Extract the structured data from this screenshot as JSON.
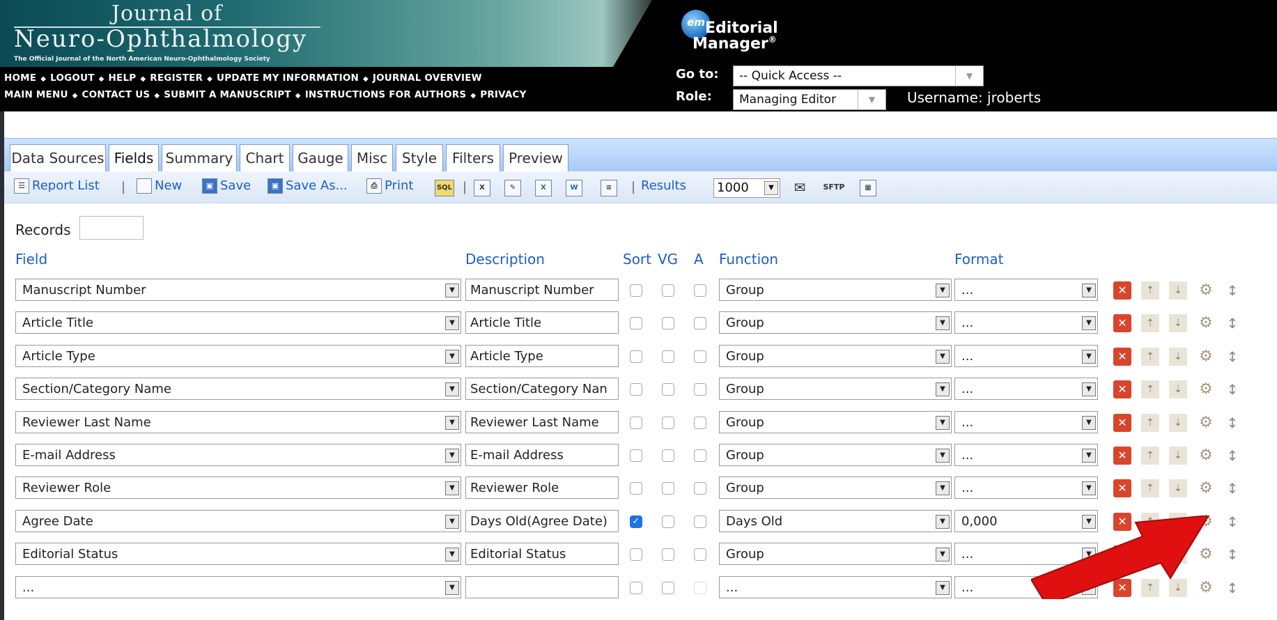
{
  "header": {
    "journal_line1": "Journal of",
    "journal_line2": "Neuro-Ophthalmology",
    "journal_sub": "The Official Journal of the North American Neuro-Ophthalmology Society",
    "nav_row1": [
      "HOME",
      "LOGOUT",
      "HELP",
      "REGISTER",
      "UPDATE MY INFORMATION",
      "JOURNAL OVERVIEW"
    ],
    "nav_row2": [
      "MAIN MENU",
      "CONTACT US",
      "SUBMIT A MANUSCRIPT",
      "INSTRUCTIONS FOR AUTHORS",
      "PRIVACY"
    ],
    "em_badge": "em",
    "em_title1": "Editorial",
    "em_title2": "Manager",
    "em_trademark": "®",
    "goto_label": "Go to:",
    "quick_access": "-- Quick Access --",
    "role_label": "Role:",
    "role_value": "Managing Editor",
    "username": "Username: jroberts"
  },
  "tabs": [
    "Data Sources",
    "Fields",
    "Summary",
    "Chart",
    "Gauge",
    "Misc",
    "Style",
    "Filters",
    "Preview"
  ],
  "active_tab": "Fields",
  "toolbar": {
    "report_list": "Report List",
    "new": "New",
    "save": "Save",
    "save_as": "Save As...",
    "print": "Print",
    "sql": "SQL",
    "sftp": "SFTP",
    "results_label": "Results",
    "results_value": "1000"
  },
  "records_label": "Records",
  "columns": {
    "field": "Field",
    "description": "Description",
    "sort": "Sort",
    "vg": "VG",
    "a": "A",
    "function": "Function",
    "format": "Format"
  },
  "rows": [
    {
      "field": "Manuscript Number",
      "description": "Manuscript Number",
      "sort": false,
      "function": "Group",
      "format": "..."
    },
    {
      "field": "Article Title",
      "description": "Article Title",
      "sort": false,
      "function": "Group",
      "format": "..."
    },
    {
      "field": "Article Type",
      "description": "Article Type",
      "sort": false,
      "function": "Group",
      "format": "..."
    },
    {
      "field": "Section/Category Name",
      "description": "Section/Category Nan",
      "sort": false,
      "function": "Group",
      "format": "..."
    },
    {
      "field": "Reviewer Last Name",
      "description": "Reviewer Last Name",
      "sort": false,
      "function": "Group",
      "format": "..."
    },
    {
      "field": "E-mail Address",
      "description": "E-mail Address",
      "sort": false,
      "function": "Group",
      "format": "..."
    },
    {
      "field": "Reviewer Role",
      "description": "Reviewer Role",
      "sort": false,
      "function": "Group",
      "format": "..."
    },
    {
      "field": "Agree Date",
      "description": "Days Old(Agree Date)",
      "sort": true,
      "function": "Days Old",
      "format": "0,000"
    },
    {
      "field": "Editorial Status",
      "description": "Editorial Status",
      "sort": false,
      "function": "Group",
      "format": "..."
    },
    {
      "field": "...",
      "description": "",
      "sort": false,
      "function": "...",
      "format": "..."
    }
  ],
  "colors": {
    "accent_link": "#1c5fc7",
    "delete_red": "#d9452c",
    "checkbox_blue": "#1a73e8",
    "annotation_red": "#e01010"
  }
}
